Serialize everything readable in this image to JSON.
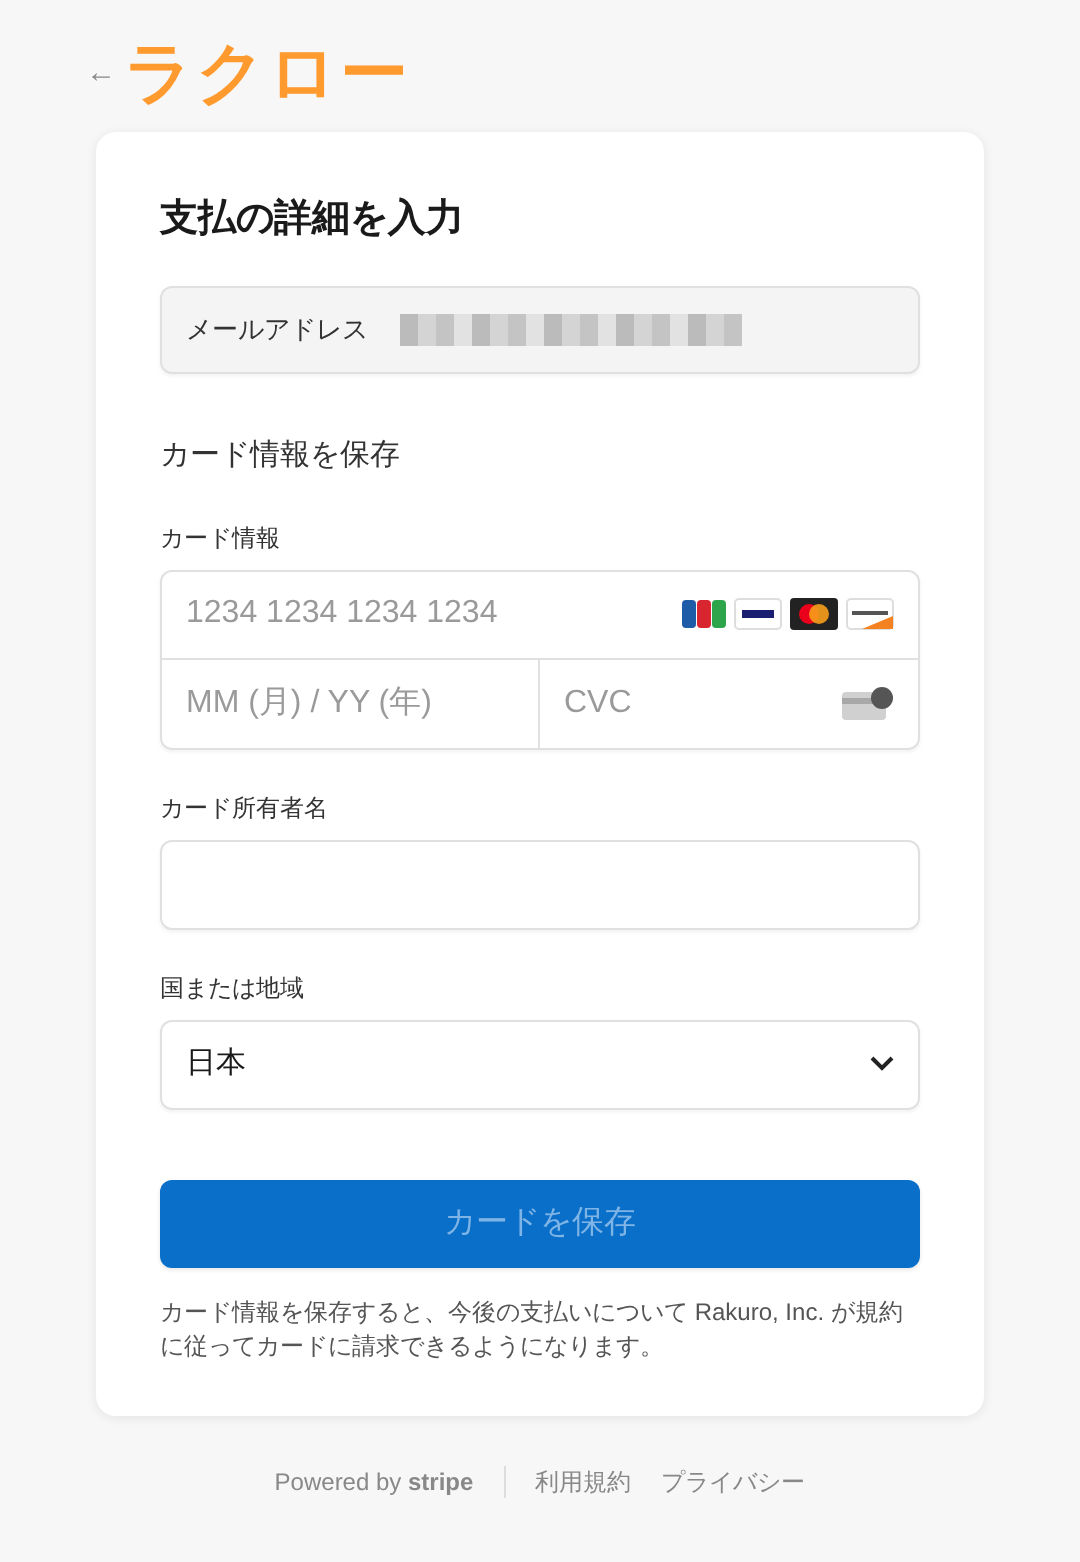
{
  "header": {
    "back": "←",
    "logo": "ラクロー"
  },
  "form": {
    "title": "支払の詳細を入力",
    "email": {
      "label": "メールアドレス",
      "value_hidden": true
    },
    "section": "カード情報を保存",
    "card": {
      "label": "カード情報",
      "number_placeholder": "1234 1234 1234 1234",
      "expiry_placeholder": "MM (月) / YY (年)",
      "cvc_placeholder": "CVC"
    },
    "holder": {
      "label": "カード所有者名"
    },
    "country": {
      "label": "国または地域",
      "value": "日本"
    },
    "submit": {
      "label": "カードを保存",
      "disabled": true
    },
    "note": "カード情報を保存すると、今後の支払いについて Rakuro, Inc. が規約に従ってカードに請求できるようになります。"
  },
  "footer": {
    "powered": "Powered by **stripe**",
    "links": [
      "利用規約",
      "プライバシー"
    ]
  }
}
